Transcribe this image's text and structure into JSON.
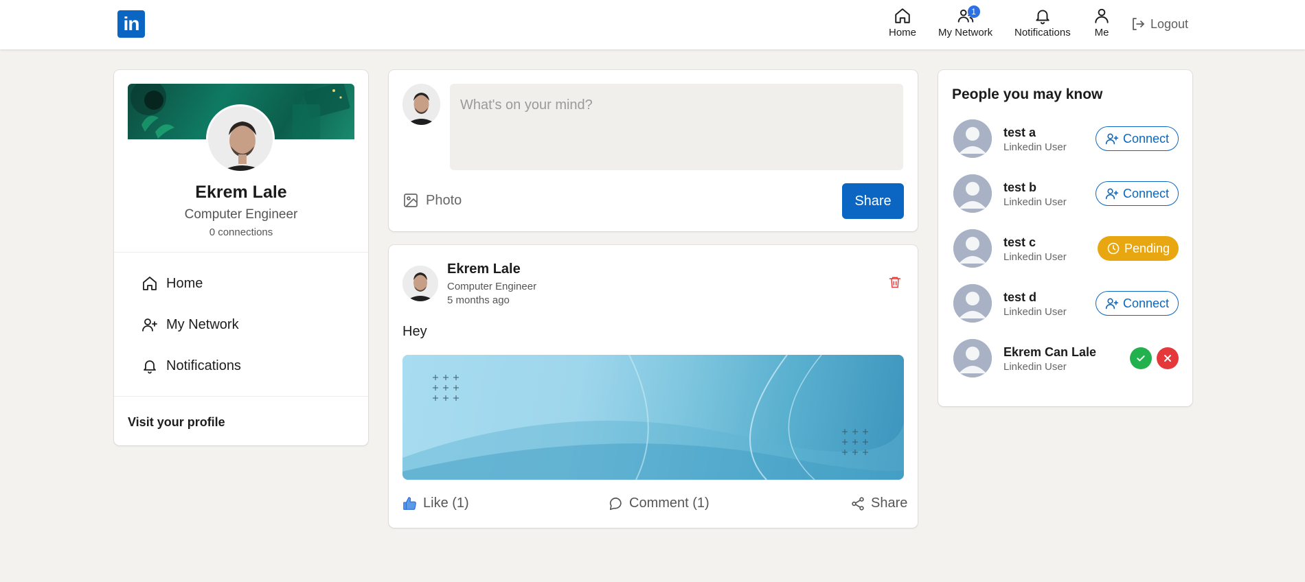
{
  "navbar": {
    "logo_text": "in",
    "items": [
      {
        "label": "Home",
        "icon": "home-icon"
      },
      {
        "label": "My Network",
        "icon": "network-icon",
        "badge": "1"
      },
      {
        "label": "Notifications",
        "icon": "bell-icon"
      },
      {
        "label": "Me",
        "icon": "user-icon"
      }
    ],
    "logout_label": "Logout"
  },
  "profile": {
    "name": "Ekrem Lale",
    "title": "Computer Engineer",
    "connections": "0 connections",
    "links": [
      {
        "label": "Home",
        "icon": "home-icon"
      },
      {
        "label": "My Network",
        "icon": "add-user-icon"
      },
      {
        "label": "Notifications",
        "icon": "bell-icon"
      }
    ],
    "visit_profile": "Visit your profile"
  },
  "composer": {
    "placeholder": "What's on your mind?",
    "photo_label": "Photo",
    "share_label": "Share"
  },
  "post": {
    "author": "Ekrem Lale",
    "subtitle": "Computer Engineer",
    "time": "5 months ago",
    "text": "Hey",
    "like_label": "Like (1)",
    "comment_label": "Comment (1)",
    "share_label": "Share"
  },
  "people": {
    "title": "People you may know",
    "list": [
      {
        "name": "test a",
        "subtitle": "Linkedin User",
        "action": "Connect"
      },
      {
        "name": "test b",
        "subtitle": "Linkedin User",
        "action": "Connect"
      },
      {
        "name": "test c",
        "subtitle": "Linkedin User",
        "action": "Pending"
      },
      {
        "name": "test d",
        "subtitle": "Linkedin User",
        "action": "Connect"
      },
      {
        "name": "Ekrem Can Lale",
        "subtitle": "Linkedin User",
        "action": "accept-reject"
      }
    ]
  },
  "colors": {
    "brand": "#0a66c2",
    "pending": "#e8a710",
    "accept": "#22b14c",
    "reject": "#e5383b",
    "delete": "#e03e3e",
    "background": "#f3f2ef"
  }
}
